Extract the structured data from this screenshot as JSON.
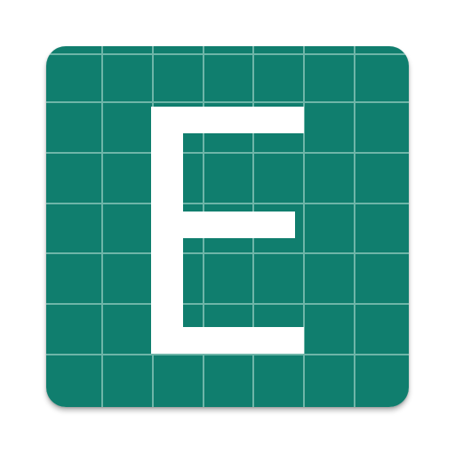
{
  "icon": {
    "letter": "E",
    "background_color": "#107e6e",
    "grid_line_color": "#7fbfb3",
    "letter_color": "#ffffff",
    "grid_columns": 7,
    "grid_rows": 7
  }
}
